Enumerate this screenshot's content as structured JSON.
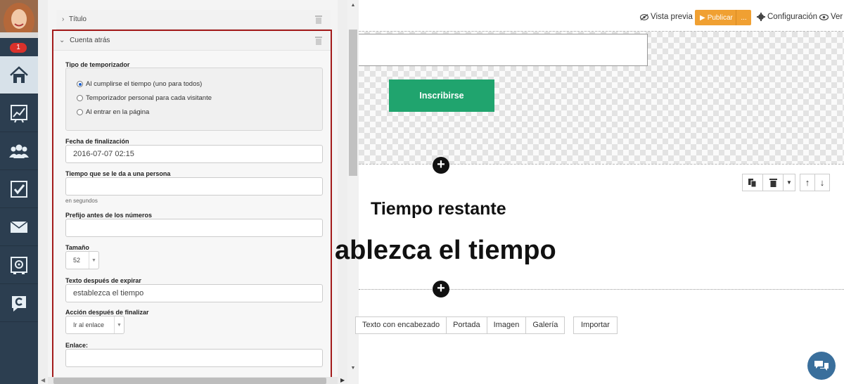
{
  "sidebar": {
    "notification_count": "1",
    "items": [
      {
        "icon": "home-icon"
      },
      {
        "icon": "statistics-icon"
      },
      {
        "icon": "contacts-icon"
      },
      {
        "icon": "tasks-icon"
      },
      {
        "icon": "email-icon"
      },
      {
        "icon": "safe-icon"
      },
      {
        "icon": "logo-c-icon"
      }
    ]
  },
  "panel": {
    "title_section": "Título",
    "countdown_section": "Cuenta atrás",
    "timer_type_label": "Tipo de temporizador",
    "timer_options": [
      "Al cumplirse el tiempo (uno para todos)",
      "Temporizador personal para cada visitante",
      "Al entrar en la página"
    ],
    "end_date_label": "Fecha de finalización",
    "end_date_value": "2016-07-07 02:15",
    "person_time_label": "Tiempo que se le da a una persona",
    "person_time_hint": "en segundos",
    "prefix_label": "Prefijo antes de los números",
    "size_label": "Tamaño",
    "size_value": "52",
    "after_text_label": "Texto después de expirar",
    "after_text_value": "establezca el tiempo",
    "after_action_label": "Acción después de finalizar",
    "after_action_value": "Ir al enlace",
    "link_label": "Enlace:"
  },
  "topbar": {
    "preview": "Vista previa",
    "publish": "Publicar",
    "publish_more": "...",
    "settings": "Configuración",
    "view": "Ver"
  },
  "canvas": {
    "subscribe": "Inscribirse",
    "countdown_title": "Tiempo restante",
    "countdown_text": "ablezca el tiempo",
    "block_types": [
      "Texto con encabezado",
      "Portada",
      "Imagen",
      "Galería"
    ],
    "import": "Importar"
  },
  "colors": {
    "sidebar": "#2c3e50",
    "publish": "#f0a032",
    "subscribe": "#20a46e",
    "highlight_border": "#a31b1b",
    "chat": "#3a6f9c"
  }
}
